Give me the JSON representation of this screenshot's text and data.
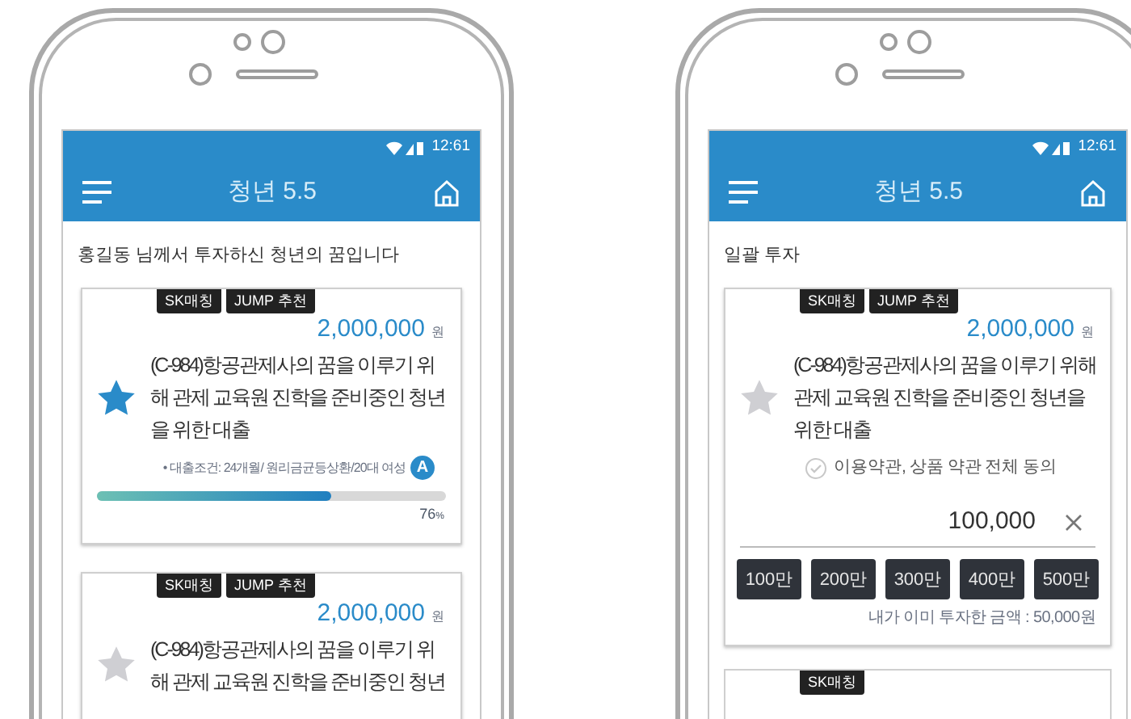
{
  "phones": [
    {
      "status_time": "12:61",
      "title": "청년 5.5",
      "heading": "홍길동 님께서 투자하신 청년의 꿈입니다",
      "cards": [
        {
          "kind": "progress",
          "tags": [
            "SK매칭",
            "JUMP 추천"
          ],
          "amount": "2,000,000",
          "unit": "원",
          "starred": true,
          "title": "(C-984)항공관제사의 꿈을 이루기 위해 관제 교육원 진학을 준비중인 청년을 위한 대출",
          "condition": "• 대출조건: 24개월/ 원리금균등상환/20대 여성",
          "grade": "A",
          "level": 0.67,
          "reading": "76",
          "reading_unit": "%"
        },
        {
          "kind": "preview",
          "tags": [
            "SK매칭",
            "JUMP 추천"
          ],
          "amount": "2,000,000",
          "unit": "원",
          "starred": false,
          "title": "(C-984)항공관제사의 꿈을 이루기 위해 관제 교육원 진학을 준비중인 청년"
        }
      ]
    },
    {
      "status_time": "12:61",
      "title": "청년 5.5",
      "heading": "일괄 투자",
      "cards": [
        {
          "kind": "invest",
          "tags": [
            "SK매칭",
            "JUMP 추천"
          ],
          "amount": "2,000,000",
          "unit": "원",
          "starred": false,
          "title": "(C-984)항공관제사의 꿈을 이루기 위해 관제 교육원 진학을 준비중인 청년을 위한 대출",
          "agreement": {
            "label": "이용약관, 상품 약관 전체 동의",
            "checked": false
          },
          "input_value": "100,000",
          "presets": [
            "100만",
            "200만",
            "300만",
            "400만",
            "500만"
          ],
          "note": "내가 이미 투자한 금액 : 50,000원"
        },
        {
          "kind": "stub",
          "tags": [
            "SK매칭"
          ]
        }
      ]
    }
  ]
}
